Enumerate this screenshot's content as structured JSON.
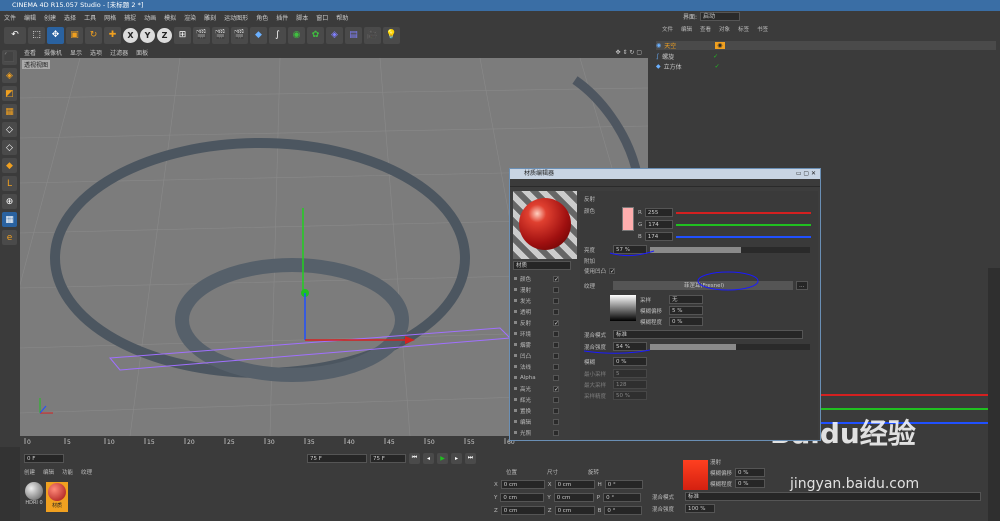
{
  "window": {
    "title": "CINEMA 4D R15.057 Studio - [未标题 2 *]"
  },
  "menu": [
    "文件",
    "编辑",
    "创建",
    "选择",
    "工具",
    "网格",
    "捕捉",
    "动画",
    "模拟",
    "渲染",
    "雕刻",
    "运动图形",
    "角色",
    "插件",
    "脚本",
    "窗口",
    "帮助"
  ],
  "layout": {
    "label": "界面:",
    "value": "启动"
  },
  "toolbar": {
    "undo": "↶",
    "x": "X",
    "y": "Y",
    "z": "Z"
  },
  "viewport": {
    "menu": [
      "查看",
      "摄像机",
      "显示",
      "选项",
      "过滤器",
      "面板"
    ],
    "name": "透视视图"
  },
  "timeline": {
    "ticks": [
      "0",
      "5",
      "10",
      "15",
      "20",
      "25",
      "30",
      "35",
      "40",
      "45",
      "50",
      "55",
      "60"
    ],
    "start": "0 F",
    "current": "0 F",
    "end": "75 F",
    "end2": "75 F"
  },
  "material_manager": {
    "menu": [
      "创建",
      "编辑",
      "功能",
      "纹理"
    ],
    "materials": [
      "HDRI 0",
      "材质"
    ]
  },
  "coords": {
    "headers": [
      "位置",
      "尺寸",
      "旋转"
    ],
    "rows": [
      [
        "X",
        "0 cm",
        "X",
        "0 cm",
        "H",
        "0 °"
      ],
      [
        "Y",
        "0 cm",
        "Y",
        "0 cm",
        "P",
        "0 °"
      ],
      [
        "Z",
        "0 cm",
        "Z",
        "0 cm",
        "B",
        "0 °"
      ]
    ]
  },
  "object_manager": {
    "menu": [
      "文件",
      "编辑",
      "查看",
      "对象",
      "标签",
      "书签"
    ],
    "objects": [
      "天空",
      "螺旋",
      "立方体"
    ]
  },
  "attr_manager": {
    "labels": [
      "漫射",
      "混合模式",
      "混合强度"
    ],
    "values": [
      "标准",
      "100 %"
    ],
    "fields": [
      {
        "label": "模糊偏移",
        "value": "0 %"
      },
      {
        "label": "模糊程度",
        "value": "0 %"
      }
    ]
  },
  "dialog": {
    "title": "材质编辑器",
    "material_name": "材质",
    "channels": [
      {
        "name": "颜色",
        "checked": true
      },
      {
        "name": "漫射",
        "checked": false
      },
      {
        "name": "发光",
        "checked": false
      },
      {
        "name": "透明",
        "checked": false
      },
      {
        "name": "反射",
        "checked": true
      },
      {
        "name": "环境",
        "checked": false
      },
      {
        "name": "烟雾",
        "checked": false
      },
      {
        "name": "凹凸",
        "checked": false
      },
      {
        "name": "法线",
        "checked": false
      },
      {
        "name": "Alpha",
        "checked": false
      },
      {
        "name": "高光",
        "checked": true
      },
      {
        "name": "辉光",
        "checked": false
      },
      {
        "name": "置换",
        "checked": false
      },
      {
        "name": "编辑",
        "checked": false
      },
      {
        "name": "光照",
        "checked": false
      }
    ],
    "section": "反射",
    "color": {
      "label": "颜色",
      "r": "255",
      "g": "174",
      "b": "174",
      "swatch": "#ffaeae"
    },
    "brightness": {
      "label": "亮度",
      "value": "57 %",
      "fraction": 0.57
    },
    "additive": "附加",
    "use_bump": "使用凹凸",
    "texture": {
      "label": "纹理",
      "shader": "菲涅耳(Fresnel)"
    },
    "sampling": {
      "label": "采样",
      "value": "无"
    },
    "blur_offset": {
      "label": "模糊偏移",
      "value": "5 %"
    },
    "blur_degree": {
      "label": "模糊程度",
      "value": "0 %"
    },
    "mix_mode": {
      "label": "混合模式",
      "value": "标准"
    },
    "mix_strength": {
      "label": "混合强度",
      "value": "54 %",
      "fraction": 0.54
    },
    "blur": {
      "label": "模糊",
      "value": "0 %"
    },
    "min_samples": {
      "label": "最小采样",
      "value": "5"
    },
    "max_samples": {
      "label": "最大采样",
      "value": "128"
    },
    "sample_accuracy": {
      "label": "采样精度",
      "value": "50 %"
    }
  },
  "watermark": {
    "brand": "Baidu经验",
    "url": "jingyan.baidu.com"
  },
  "colors": {
    "accent": "#2a62a0",
    "annotation": "#1a1aff",
    "red": "#d42020",
    "green": "#20c020",
    "blue": "#2050ff"
  }
}
